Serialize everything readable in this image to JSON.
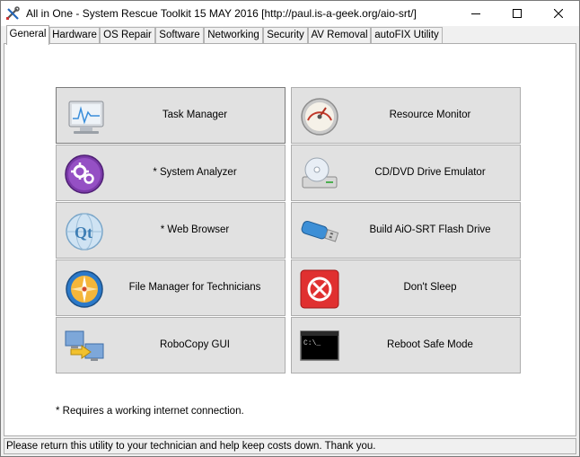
{
  "window": {
    "title": "All in One - System Rescue Toolkit 15 MAY 2016 [http://paul.is-a-geek.org/aio-srt/]",
    "app_icon": "toolkit-icon",
    "controls": [
      "minimize-icon",
      "maximize-icon",
      "close-icon"
    ]
  },
  "tabs": [
    {
      "label": "General",
      "active": true
    },
    {
      "label": "Hardware",
      "active": false
    },
    {
      "label": "OS Repair",
      "active": false
    },
    {
      "label": "Software",
      "active": false
    },
    {
      "label": "Networking",
      "active": false
    },
    {
      "label": "Security",
      "active": false
    },
    {
      "label": "AV Removal",
      "active": false
    },
    {
      "label": "autoFIX Utility",
      "active": false
    }
  ],
  "buttons": {
    "left": [
      {
        "label": "Task Manager",
        "icon": "task-manager-monitor-icon"
      },
      {
        "label": "* System Analyzer",
        "icon": "gears-icon"
      },
      {
        "label": "* Web Browser",
        "icon": "qt-globe-icon"
      },
      {
        "label": "File Manager for Technicians",
        "icon": "compass-icon"
      },
      {
        "label": "RoboCopy GUI",
        "icon": "copy-computers-icon"
      }
    ],
    "right": [
      {
        "label": "Resource Monitor",
        "icon": "gauge-icon"
      },
      {
        "label": "CD/DVD Drive Emulator",
        "icon": "optical-drive-icon"
      },
      {
        "label": "Build AiO-SRT Flash Drive",
        "icon": "usb-flash-drive-icon"
      },
      {
        "label": "Don't Sleep",
        "icon": "no-sleep-icon"
      },
      {
        "label": "Reboot Safe Mode",
        "icon": "command-prompt-icon"
      }
    ]
  },
  "footnote": "* Requires a working internet connection.",
  "status": "Please return this utility to your technician and help keep costs down. Thank you.",
  "colors": {
    "accent_purple": "#7a3aa8",
    "red": "#e03030",
    "blue": "#2b79c9"
  }
}
